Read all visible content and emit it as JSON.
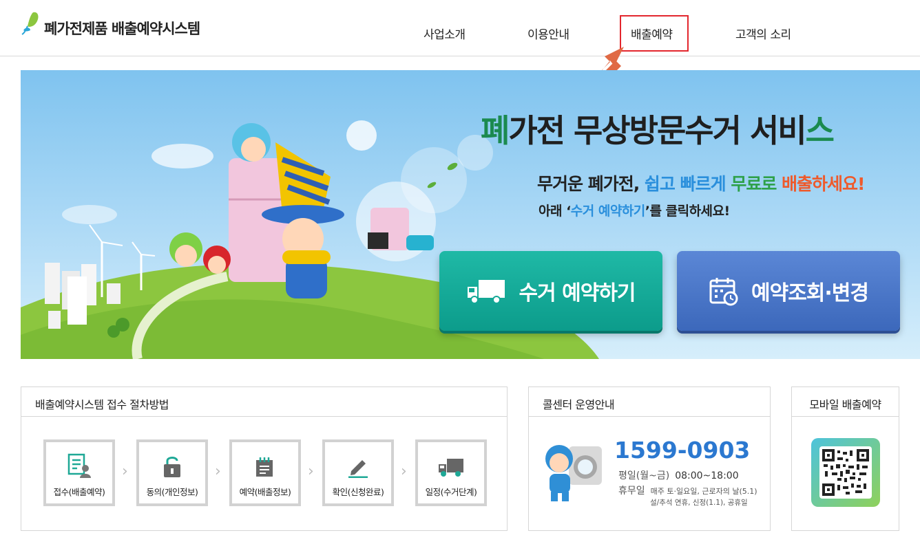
{
  "header": {
    "logo_title": "폐가전제품 배출예약시스템",
    "nav": [
      "사업소개",
      "이용안내",
      "배출예약",
      "고객의 소리"
    ]
  },
  "banner": {
    "headline": {
      "p1": "폐",
      "p2": "가전 무상방문수거 서비",
      "p3": "스"
    },
    "subline": {
      "a": "무거운 폐가전, ",
      "b": "쉽고 빠르게 ",
      "c": "무료로 ",
      "d": "배출하세요!"
    },
    "subline2": {
      "a": "아래 ‘",
      "b": "수거 예약하기",
      "c": "’를 클릭하세요!"
    },
    "buttons": {
      "collect": "수거 예약하기",
      "check": "예약조회·변경"
    }
  },
  "procedure": {
    "title": "배출예약시스템 접수 절차방법",
    "steps": [
      {
        "label": "접수(배출예약)",
        "icon": "document-user-icon"
      },
      {
        "label": "동의(개인정보)",
        "icon": "lock-icon"
      },
      {
        "label": "예약(배출정보)",
        "icon": "notepad-icon"
      },
      {
        "label": "확인(신청완료)",
        "icon": "pencil-icon"
      },
      {
        "label": "일정(수거단계)",
        "icon": "truck-icon"
      }
    ]
  },
  "callcenter": {
    "title": "콜센터 운영안내",
    "phone": "1599-0903",
    "weekday_key": "평일(월~금)",
    "weekday_val": "08:00~18:00",
    "closed_key": "휴무일",
    "closed_val": "매주 토·일요일, 근로자의 날(5.1)",
    "closed_note": "설/추석 연휴, 신정(1.1), 공휴일"
  },
  "mobile": {
    "title": "모바일 배출예약"
  },
  "colors": {
    "accent_red": "#e3262d",
    "collect_button": "#12a896",
    "check_button": "#4a76c8",
    "phone": "#2b78d0",
    "headline_green": "#1b8a4f"
  }
}
